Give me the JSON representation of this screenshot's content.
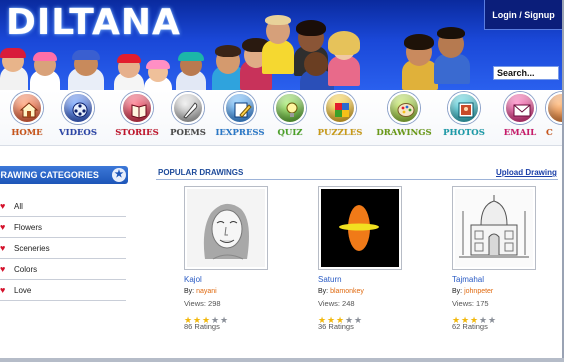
{
  "brand": {
    "logo_text": "DILTANA"
  },
  "header": {
    "login_label": "Login / Signup",
    "search_placeholder": "Search..."
  },
  "nav": {
    "items": [
      {
        "label": "HOME",
        "color": "#c8541a",
        "icon": "house-icon"
      },
      {
        "label": "VIDEOS",
        "color": "#2a44a6",
        "icon": "film-reel-icon"
      },
      {
        "label": "STORIES",
        "color": "#c0142a",
        "icon": "book-icon"
      },
      {
        "label": "POEMS",
        "color": "#4a4a4a",
        "icon": "quill-pen-icon"
      },
      {
        "label": "IEXPRESS",
        "color": "#2a78c8",
        "icon": "pencil-paper-icon"
      },
      {
        "label": "QUIZ",
        "color": "#4aa028",
        "icon": "lightbulb-icon"
      },
      {
        "label": "PUZZLES",
        "color": "#c89a18",
        "icon": "puzzle-icon"
      },
      {
        "label": "DRAWINGS",
        "color": "#6a9a18",
        "icon": "palette-icon"
      },
      {
        "label": "PHOTOS",
        "color": "#1a9aa8",
        "icon": "photo-frame-icon"
      },
      {
        "label": "EMAIL",
        "color": "#c81a6a",
        "icon": "envelope-icon"
      },
      {
        "label": "C",
        "color": "#c8541a",
        "icon": "partial-icon"
      }
    ]
  },
  "sidebar": {
    "title": "DRAWING CATEGORIES",
    "categories": [
      "All",
      "Flowers",
      "Sceneries",
      "Colors",
      "Love"
    ]
  },
  "main": {
    "section_title": "POPULAR DRAWINGS",
    "upload_label": "Upload Drawing",
    "drawings": [
      {
        "title": "Kajol",
        "by_prefix": "By:",
        "author": "nayani",
        "views": "Views: 298",
        "rating": 3,
        "max": 5,
        "ratings": "86 Ratings"
      },
      {
        "title": "Saturn",
        "by_prefix": "By:",
        "author": "blamonkey",
        "views": "Views: 248",
        "rating": 3,
        "max": 5,
        "ratings": "36 Ratings"
      },
      {
        "title": "Tajmahal",
        "by_prefix": "By:",
        "author": "johnpeter",
        "views": "Views: 175",
        "rating": 3,
        "max": 5,
        "ratings": "62 Ratings"
      }
    ]
  },
  "colors": {
    "banner_blue": "#1a48d8",
    "accent_orange": "#e06a10",
    "link_blue": "#2a5bc4",
    "star_gold": "#f2b80c",
    "heart_red": "#d4102a"
  }
}
